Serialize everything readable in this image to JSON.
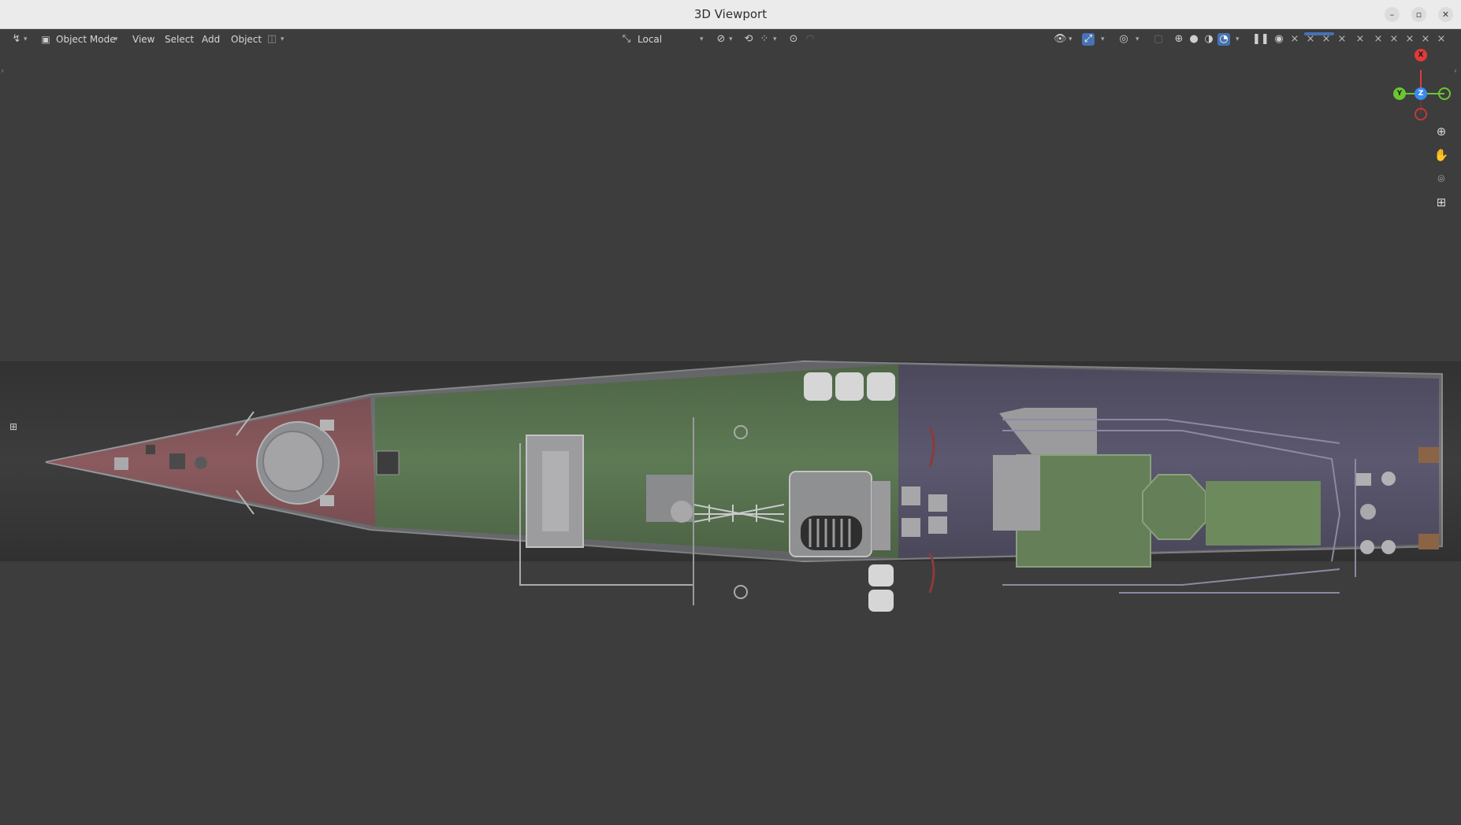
{
  "window": {
    "title": "3D Viewport",
    "minimize": "–",
    "maximize": "▫",
    "close": "✕"
  },
  "header": {
    "editor_type_icon": "↯",
    "mode_label": "Object Mode",
    "menus": [
      "View",
      "Select",
      "Add",
      "Object"
    ],
    "transform_orientation": "Local",
    "colors": {
      "active_blue": "#4772b3",
      "header_bg": "#3d3d3d",
      "viewport_bg": "#3d3d3d"
    }
  },
  "gizmo": {
    "x_label": "X",
    "y_label": "Y",
    "z_label": "Z",
    "colors": {
      "x": "#e23a3a",
      "y": "#6ac633",
      "z": "#3a8bee"
    }
  },
  "nav_icons": [
    "zoom-icon",
    "pan-hand-icon",
    "camera-icon",
    "grid-ortho-icon"
  ],
  "model": {
    "description_colors": {
      "bow": "#8a5a5e",
      "mid_deck": "#5e7a55",
      "stern_deck": "#5c5870"
    }
  }
}
